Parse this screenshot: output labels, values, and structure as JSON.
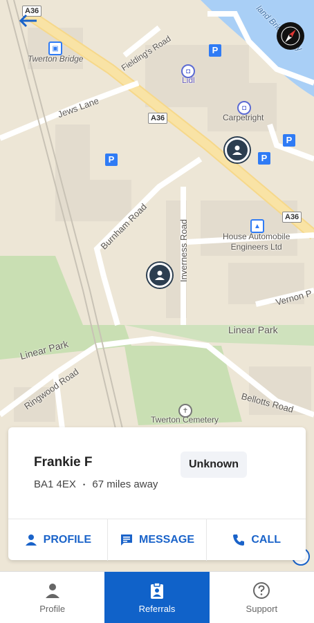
{
  "map": {
    "labels": {
      "twerton_bridge": "Twerton Bridge",
      "fielding_road": "Fielding's Road",
      "lidl": "Lidl",
      "jews_lane": "Jews Lane",
      "a36_top": "A36",
      "a36_mid": "A36",
      "a36_right": "A36",
      "carpetright": "Carpetright",
      "burnham_road": "Burnham Road",
      "inverness_road": "Inverness Road",
      "house_auto": "House Automobile\nEngineers Ltd",
      "vernon": "Vernon P",
      "linear_park_right": "Linear Park",
      "linear_park_left": "Linear Park",
      "ringwood_road": "Ringwood Road",
      "bellotts_road": "Bellotts Road",
      "twerton_cemetery": "Twerton Cemetery",
      "river_text": "land Bridge Way"
    },
    "parking_label": "P",
    "pins": [
      {
        "name": "person-pin-icon"
      },
      {
        "name": "person-pin-icon"
      }
    ]
  },
  "card": {
    "name": "Frankie F",
    "postcode": "BA1 4EX",
    "separator": "•",
    "distance": "67 miles away",
    "status": "Unknown",
    "actions": {
      "profile": "PROFILE",
      "message": "MESSAGE",
      "call": "CALL"
    }
  },
  "nav": {
    "profile": "Profile",
    "referrals": "Referrals",
    "support": "Support"
  },
  "colors": {
    "accent": "#1a63c9",
    "nav_active": "#1062c9",
    "pin": "#2c3e50"
  }
}
